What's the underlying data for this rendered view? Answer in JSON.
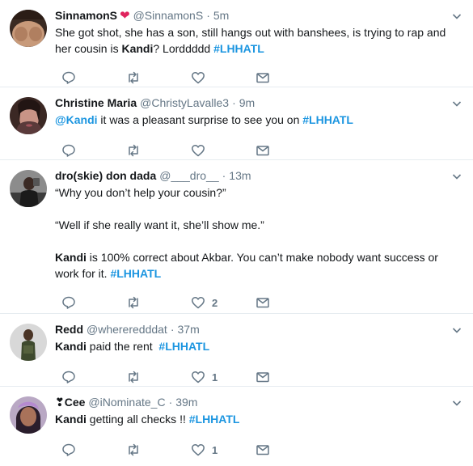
{
  "tweets": [
    {
      "name": "SinnamonS",
      "handle": "@SinnamonS",
      "time": "5m",
      "text_parts": {
        "t1": "She got shot, she has a son, still hangs out with banshees, is trying to rap and her cousin is ",
        "b1": "Kandi",
        "t2": "? Lorddddd ",
        "tag": "#LHHATL"
      },
      "likes": ""
    },
    {
      "name": "Christine Maria",
      "handle": "@ChristyLavalle3",
      "time": "9m",
      "text_parts": {
        "mention": "@Kandi",
        "t1": " it was a pleasant surprise to see you on ",
        "tag": "#LHHATL"
      },
      "likes": ""
    },
    {
      "name": "dro(skie) don dada",
      "handle": "@___dro__",
      "time": "13m",
      "text_parts": {
        "p1": "“Why you don’t help your cousin?”",
        "p2": "“Well if she really want it, she’ll show me.”",
        "b1": "Kandi",
        "t1": " is 100% correct about Akbar. You can’t make nobody want success or work for it. ",
        "tag": "#LHHATL"
      },
      "likes": "2"
    },
    {
      "name": "Redd",
      "handle": "@whereredddat",
      "time": "37m",
      "text_parts": {
        "b1": "Kandi",
        "t1": " paid the rent  ",
        "tag": "#LHHATL"
      },
      "likes": "1"
    },
    {
      "name": "❣Cee",
      "handle": "@iNominate_C",
      "time": "39m",
      "text_parts": {
        "b1": "Kandi",
        "t1": " getting all checks !! ",
        "tag": "#LHHATL"
      },
      "likes": "1"
    }
  ],
  "icons": {
    "reply": "reply-icon",
    "retweet": "retweet-icon",
    "like": "like-icon",
    "dm": "direct-message-icon",
    "more": "chevron-down-icon",
    "heart_emoji": "red-heart-emoji"
  },
  "colors": {
    "hashtag": "#1b95e0",
    "meta": "#657786",
    "divider": "#e6ecf0",
    "heart": "#e0245e"
  }
}
